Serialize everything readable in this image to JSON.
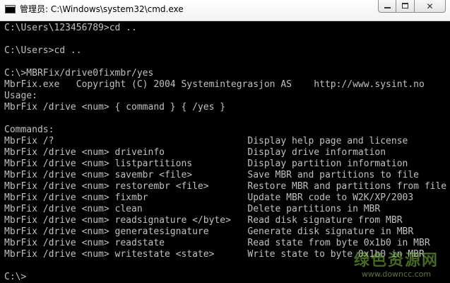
{
  "window": {
    "title": "管理员: C:\\Windows\\system32\\cmd.exe",
    "close_glyph": "✕"
  },
  "console": {
    "lines": [
      "C:\\Users\\123456789>cd ..",
      "",
      "C:\\Users>cd ..",
      "",
      "C:\\>MBRFix/drive0fixmbr/yes",
      "MbrFix.exe   Copyright (C) 2004 Systemintegrasjon AS    http://www.sysint.no",
      "Usage:",
      "MbrFix /drive <num> { command } { /yes }",
      "",
      "Commands:",
      "MbrFix /?                                   Display help page and license",
      "MbrFix /drive <num> driveinfo               Display drive information",
      "MbrFix /drive <num> listpartitions          Display partition information",
      "MbrFix /drive <num> savembr <file>          Save MBR and partitions to file",
      "MbrFix /drive <num> restorembr <file>       Restore MBR and partitions from file",
      "MbrFix /drive <num> fixmbr                  Update MBR code to W2K/XP/2003",
      "MbrFix /drive <num> clean                   Delete partitions in MBR",
      "MbrFix /drive <num> readsignature </byte>   Read disk signature from MBR",
      "MbrFix /drive <num> generatesignature       Generate disk signature in MBR",
      "MbrFix /drive <num> readstate               Read state from byte 0x1b0 in MBR",
      "MbrFix /drive <num> writestate <state>      Write state to byte 0x1b0 in MBR",
      "",
      "C:\\>"
    ]
  },
  "watermark": {
    "main": "绿色资源网",
    "sub": "www.downcc.com"
  },
  "colors": {
    "console_bg": "#000000",
    "console_fg": "#c0c0c0",
    "watermark": "#7fbf3f"
  }
}
